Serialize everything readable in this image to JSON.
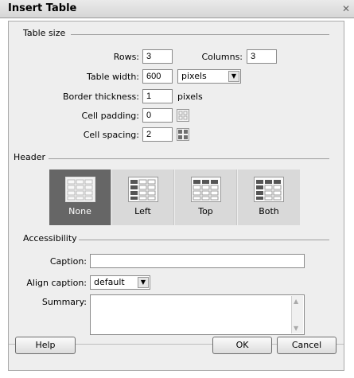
{
  "window": {
    "title": "Insert Table"
  },
  "table_size": {
    "heading": "Table size",
    "rows_label": "Rows:",
    "rows_value": "3",
    "columns_label": "Columns:",
    "columns_value": "3",
    "width_label": "Table width:",
    "width_value": "600",
    "width_unit": "pixels",
    "border_label": "Border thickness:",
    "border_value": "1",
    "border_unit": "pixels",
    "padding_label": "Cell padding:",
    "padding_value": "0",
    "spacing_label": "Cell spacing:",
    "spacing_value": "2"
  },
  "header": {
    "heading": "Header",
    "options": [
      "None",
      "Left",
      "Top",
      "Both"
    ],
    "selected": "None"
  },
  "accessibility": {
    "heading": "Accessibility",
    "caption_label": "Caption:",
    "caption_value": "",
    "align_label": "Align caption:",
    "align_value": "default",
    "summary_label": "Summary:",
    "summary_value": ""
  },
  "buttons": {
    "help": "Help",
    "ok": "OK",
    "cancel": "Cancel"
  },
  "colors": {
    "selected_option_bg": "#666666",
    "option_bg": "#d9d9d9",
    "dialog_bg": "#eeeeee"
  }
}
